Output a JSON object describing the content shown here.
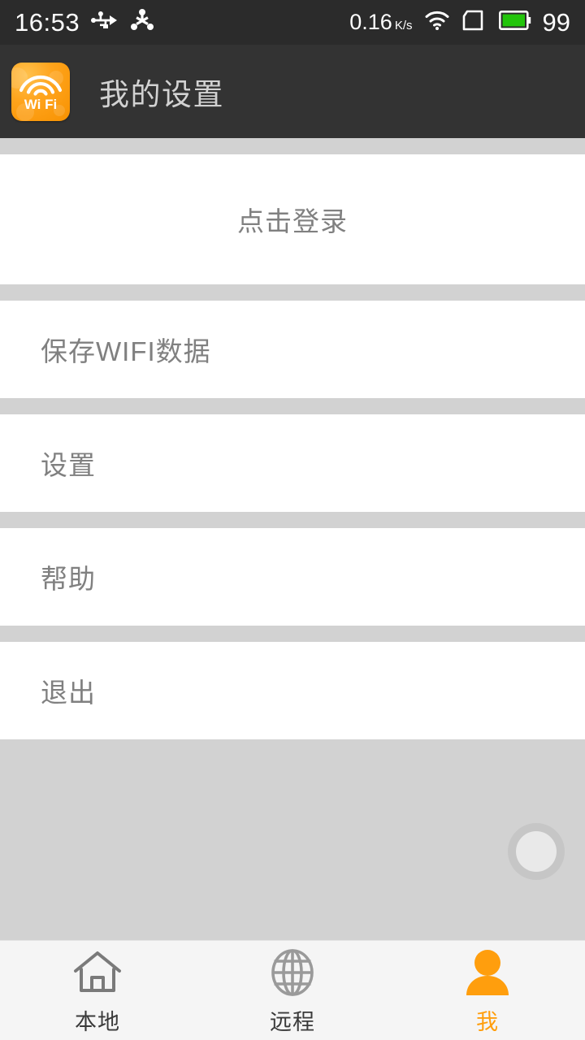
{
  "status_bar": {
    "time": "16:53",
    "icons_left": [
      "usb-icon",
      "share-network-icon"
    ],
    "network_speed": "0.16",
    "network_speed_unit": "K/s",
    "icons_right": [
      "wifi-icon",
      "sim-card-icon",
      "battery-icon"
    ],
    "battery_level": "99",
    "battery_color": "#22c40b",
    "background": "#2b2b2b"
  },
  "header": {
    "title": "我的设置",
    "logo_text_line1": "Wi",
    "logo_text_line2": "Fi",
    "logo_icon": "wifi-arc-icon",
    "logo_color": "#ffa41c",
    "background": "#333333"
  },
  "main": {
    "login_row": {
      "label": "点击登录"
    },
    "menu_items": [
      {
        "label": "保存WIFI数据",
        "name": "saved-wifi-data"
      },
      {
        "label": "设置",
        "name": "settings"
      },
      {
        "label": "帮助",
        "name": "help"
      },
      {
        "label": "退出",
        "name": "exit"
      }
    ],
    "floating_button": {
      "icon": "circle-button-icon"
    },
    "text_color": "#808080",
    "divider_color": "#d2d2d2"
  },
  "tab_bar": {
    "items": [
      {
        "label": "本地",
        "icon": "home-icon",
        "active": false
      },
      {
        "label": "远程",
        "icon": "globe-icon",
        "active": false
      },
      {
        "label": "我",
        "icon": "person-icon",
        "active": true
      }
    ],
    "active_color": "#ff9e0d",
    "inactive_color": "#7a7a7a",
    "background": "#f5f5f5"
  }
}
